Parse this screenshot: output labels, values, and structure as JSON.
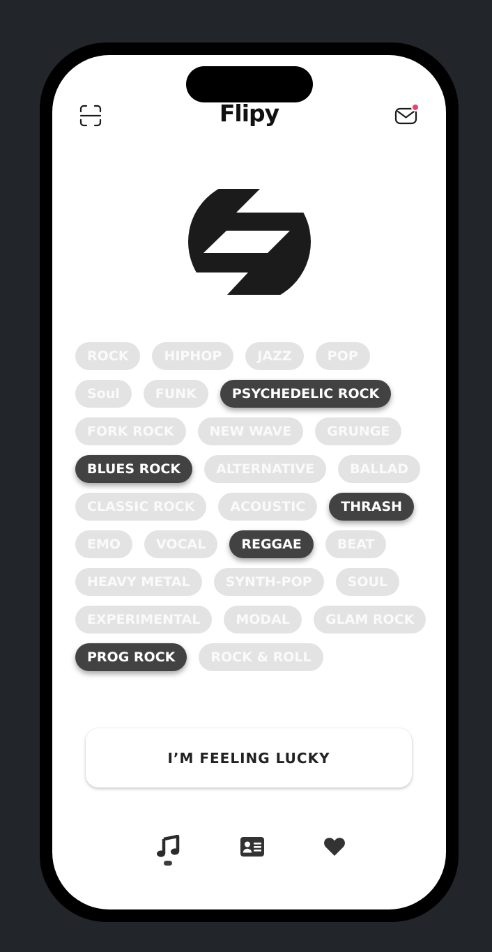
{
  "app": {
    "title": "Flipy",
    "scan_icon": "scan-icon",
    "mail_icon": "mail-icon",
    "notification_color": "#e0476e"
  },
  "genres": [
    {
      "label": "ROCK",
      "selected": false
    },
    {
      "label": "HIPHOP",
      "selected": false
    },
    {
      "label": "JAZZ",
      "selected": false
    },
    {
      "label": "POP",
      "selected": false
    },
    {
      "label": "Soul",
      "selected": false
    },
    {
      "label": "FUNK",
      "selected": false
    },
    {
      "label": "PSYCHEDELIC ROCK",
      "selected": true
    },
    {
      "label": "FORK ROCK",
      "selected": false
    },
    {
      "label": "NEW WAVE",
      "selected": false
    },
    {
      "label": "GRUNGE",
      "selected": false
    },
    {
      "label": "BLUES ROCK",
      "selected": true
    },
    {
      "label": "ALTERNATIVE",
      "selected": false
    },
    {
      "label": "BALLAD",
      "selected": false
    },
    {
      "label": "CLASSIC ROCK",
      "selected": false
    },
    {
      "label": "ACOUSTIC",
      "selected": false
    },
    {
      "label": "THRASH",
      "selected": true
    },
    {
      "label": "EMO",
      "selected": false
    },
    {
      "label": "VOCAL",
      "selected": false
    },
    {
      "label": "REGGAE",
      "selected": true
    },
    {
      "label": "BEAT",
      "selected": false
    },
    {
      "label": "HEAVY METAL",
      "selected": false
    },
    {
      "label": "SYNTH-POP",
      "selected": false
    },
    {
      "label": "SOUL",
      "selected": false
    },
    {
      "label": "EXPERIMENTAL",
      "selected": false
    },
    {
      "label": "MODAL",
      "selected": false
    },
    {
      "label": "GLAM ROCK",
      "selected": false
    },
    {
      "label": "PROG ROCK",
      "selected": true
    },
    {
      "label": "ROCK & ROLL",
      "selected": false
    }
  ],
  "lucky_button": {
    "label": "I’M FEELING LUCKY"
  },
  "bottom_nav": {
    "items": [
      {
        "icon": "music-note-icon",
        "active": true
      },
      {
        "icon": "id-card-icon",
        "active": false
      },
      {
        "icon": "heart-icon",
        "active": false
      }
    ]
  },
  "colors": {
    "tag_unselected_bg": "#e4e3e4",
    "tag_selected_bg": "#424242",
    "ink": "#1a1a1a"
  }
}
